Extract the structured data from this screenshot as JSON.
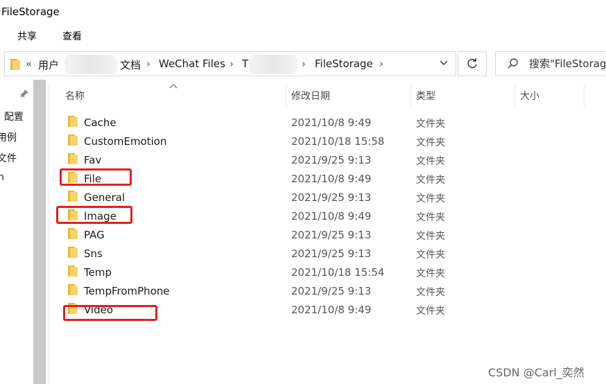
{
  "window": {
    "title": "FileStorage"
  },
  "ribbon": {
    "tabs": [
      "共享",
      "查看"
    ]
  },
  "address_bar": {
    "overflow": "«",
    "crumbs": [
      "用户",
      "文档",
      "WeChat Files",
      "T",
      "FileStorage"
    ],
    "separator": "›",
    "dropdown": "⌄"
  },
  "search": {
    "placeholder": "搜索\"FileStorage\""
  },
  "nav_pane": {
    "items": [
      "配置",
      "用例",
      "文件",
      "n"
    ]
  },
  "columns": {
    "name": "名称",
    "modified": "修改日期",
    "type": "类型",
    "size": "大小"
  },
  "files": [
    {
      "name": "Cache",
      "modified": "2021/10/8 9:49",
      "type": "文件夹"
    },
    {
      "name": "CustomEmotion",
      "modified": "2021/10/18 15:58",
      "type": "文件夹"
    },
    {
      "name": "Fav",
      "modified": "2021/9/25 9:13",
      "type": "文件夹"
    },
    {
      "name": "File",
      "modified": "2021/10/8 9:49",
      "type": "文件夹"
    },
    {
      "name": "General",
      "modified": "2021/9/25 9:13",
      "type": "文件夹"
    },
    {
      "name": "Image",
      "modified": "2021/10/8 9:49",
      "type": "文件夹"
    },
    {
      "name": "PAG",
      "modified": "2021/9/25 9:13",
      "type": "文件夹"
    },
    {
      "name": "Sns",
      "modified": "2021/9/25 9:13",
      "type": "文件夹"
    },
    {
      "name": "Temp",
      "modified": "2021/10/18 15:54",
      "type": "文件夹"
    },
    {
      "name": "TempFromPhone",
      "modified": "2021/9/25 9:13",
      "type": "文件夹"
    },
    {
      "name": "Video",
      "modified": "2021/10/8 9:49",
      "type": "文件夹"
    }
  ],
  "watermark": "CSDN @Carl_奕然",
  "colors": {
    "folder": "#f2c94c",
    "highlight": "#e02020"
  }
}
